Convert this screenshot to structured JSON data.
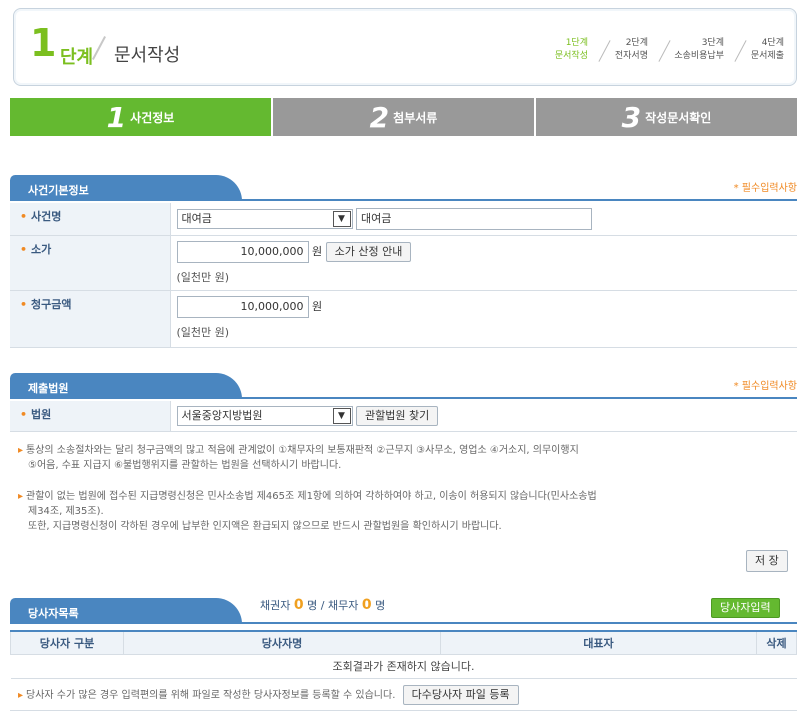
{
  "stage": {
    "number": "1",
    "unit": "단계",
    "title": "문서작성",
    "steps": [
      {
        "top": "1단계",
        "bottom": "문서작성"
      },
      {
        "top": "2단계",
        "bottom": "전자서명"
      },
      {
        "top": "3단계",
        "bottom": "소송비용납부"
      },
      {
        "top": "4단계",
        "bottom": "문서제출"
      }
    ]
  },
  "tabs": [
    {
      "num": "1",
      "label": "사건정보"
    },
    {
      "num": "2",
      "label": "첨부서류"
    },
    {
      "num": "3",
      "label": "작성문서확인"
    }
  ],
  "basic": {
    "title": "사건기본정보",
    "required": "* 필수입력사항",
    "case_name_label": "사건명",
    "case_select": "대여금",
    "case_input": "대여금",
    "value_label": "소가",
    "value_amount": "10,000,000",
    "unit": "원",
    "value_help_button": "소가 산정 안내",
    "value_words": "(일천만 원)",
    "claim_label": "청구금액",
    "claim_amount": "10,000,000",
    "claim_words": "(일천만 원)"
  },
  "court": {
    "title": "제출법원",
    "required": "* 필수입력사항",
    "court_label": "법원",
    "court_select": "서울중앙지방법원",
    "find_button": "관할법원 찾기",
    "note1_line1": "통상의 소송절차와는 달리 청구금액의 많고 적음에 관계없이 ①채무자의 보통재판적 ②근무지 ③사무소, 영업소 ④거소지, 의무이행지",
    "note1_line2": "⑤어음, 수표 지급지 ⑥불법행위지를 관할하는 법원을 선택하시기 바랍니다.",
    "note2_line1": "관할이 없는 법원에 접수된 지급명령신청은 민사소송법 제465조 제1항에 의하여 각하하여야 하고, 이송이 허용되지 않습니다(민사소송법",
    "note2_line2": "제34조, 제35조).",
    "note2_line3": "또한, 지급명령신청이 각하된 경우에 납부한 인지액은 환급되지 않으므로 반드시 관할법원을 확인하시기 바랍니다.",
    "save_button": "저 장"
  },
  "parties": {
    "title": "당사자목록",
    "creditor_label": "채권자",
    "creditor_count": "0",
    "debtor_label": "채무자",
    "debtor_count": "0",
    "person_unit": "명",
    "separator": "/",
    "add_button": "당사자입력",
    "columns": [
      "당사자 구분",
      "당사자명",
      "대표자",
      "삭제"
    ],
    "empty_message": "조회결과가 존재하지 않습니다.",
    "bulk_note": "당사자 수가 많은 경우 입력편의를 위해 파일로 작성한 당사자정보를 등록할 수 있습니다.",
    "bulk_button": "다수당사자 파일 등록"
  }
}
